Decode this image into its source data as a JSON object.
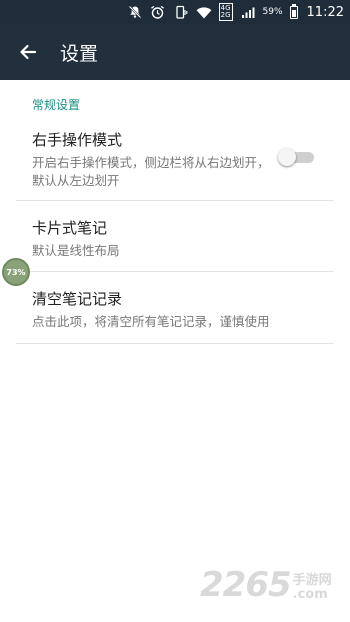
{
  "status_bar": {
    "network_top": "4G",
    "network_bottom": "2G",
    "battery_percent": "59%",
    "time": "11:22",
    "icons": [
      "notifications-off-icon",
      "alarm-icon",
      "vibrate-icon",
      "wifi-icon",
      "signal-icon",
      "battery-icon"
    ]
  },
  "app_bar": {
    "title": "设置",
    "back_icon": "arrow-left-icon"
  },
  "section": {
    "header": "常规设置"
  },
  "items": [
    {
      "title": "右手操作模式",
      "subtitle": "开启右手操作模式，侧边栏将从右边划开，默认从左边划开",
      "toggle_on": false
    },
    {
      "title": "卡片式笔记",
      "subtitle": "默认是线性布局"
    },
    {
      "title": "清空笔记记录",
      "subtitle": "点击此项，将清空所有笔记记录，谨慎使用"
    }
  ],
  "floating_badge": {
    "label": "73%"
  },
  "watermark": {
    "number": "2265",
    "site_cn": "手游网",
    "site_en": ".com"
  },
  "colors": {
    "app_bar": "#222f3c",
    "status_bar": "#1f2d3a",
    "section_header": "#1a8f86"
  }
}
